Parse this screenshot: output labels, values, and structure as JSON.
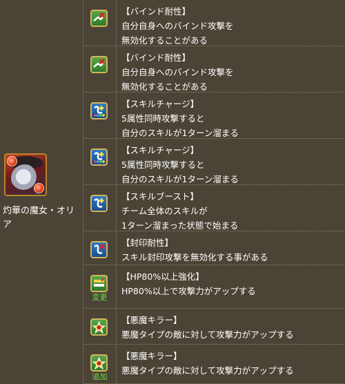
{
  "character": {
    "name_line1": "灼華の魔女・オリ",
    "name_line2": "ア"
  },
  "colors": {
    "background": "#4a4234",
    "divider": "#6b6150",
    "tag_text": "#6fdc4a"
  },
  "awakenings": [
    {
      "icon": "bind-resist-icon",
      "title": "【バインド耐性】",
      "lines": [
        "自分自身へのバインド攻撃を",
        "無効化することがある"
      ],
      "tag": ""
    },
    {
      "icon": "bind-resist-icon",
      "title": "【バインド耐性】",
      "lines": [
        "自分自身へのバインド攻撃を",
        "無効化することがある"
      ],
      "tag": ""
    },
    {
      "icon": "skill-charge-icon",
      "title": "【スキルチャージ】",
      "lines": [
        "5属性同時攻撃すると",
        "自分のスキルが1ターン溜まる"
      ],
      "tag": ""
    },
    {
      "icon": "skill-charge-icon",
      "title": "【スキルチャージ】",
      "lines": [
        "5属性同時攻撃すると",
        "自分のスキルが1ターン溜まる"
      ],
      "tag": ""
    },
    {
      "icon": "skill-boost-icon",
      "title": "【スキルブースト】",
      "lines": [
        "チーム全体のスキルが",
        "1ターン溜まった状態で始まる"
      ],
      "tag": ""
    },
    {
      "icon": "skill-bind-resist-icon",
      "title": "【封印耐性】",
      "lines": [
        "スキル封印攻撃を無効化する事がある"
      ],
      "tag": ""
    },
    {
      "icon": "hp80-enhance-icon",
      "title": "【HP80%以上強化】",
      "lines": [
        "HP80%以上で攻撃力がアップする"
      ],
      "tag": "変更"
    },
    {
      "icon": "devil-killer-icon",
      "title": "【悪魔キラー】",
      "lines": [
        "悪魔タイプの敵に対して攻撃力がアップする"
      ],
      "tag": ""
    },
    {
      "icon": "devil-killer-icon",
      "title": "【悪魔キラー】",
      "lines": [
        "悪魔タイプの敵に対して攻撃力がアップする"
      ],
      "tag": "追加"
    }
  ]
}
